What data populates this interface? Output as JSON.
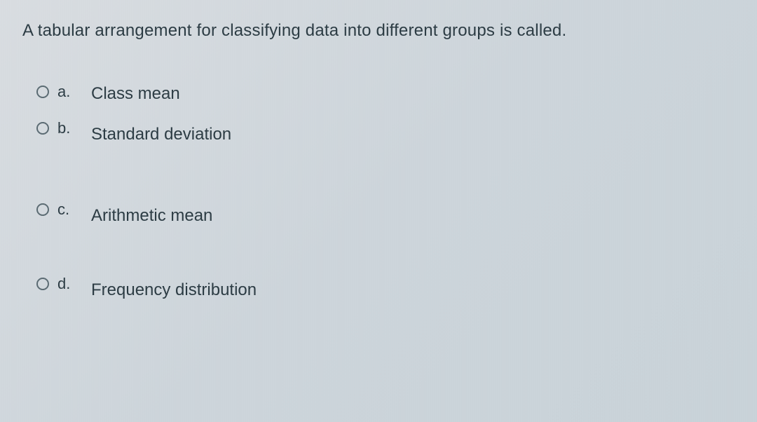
{
  "question": {
    "text": "A tabular arrangement for classifying data into different groups is called."
  },
  "options": [
    {
      "letter": "a.",
      "text": "Class mean"
    },
    {
      "letter": "b.",
      "text": "Standard deviation"
    },
    {
      "letter": "c.",
      "text": "Arithmetic mean"
    },
    {
      "letter": "d.",
      "text": "Frequency distribution"
    }
  ]
}
